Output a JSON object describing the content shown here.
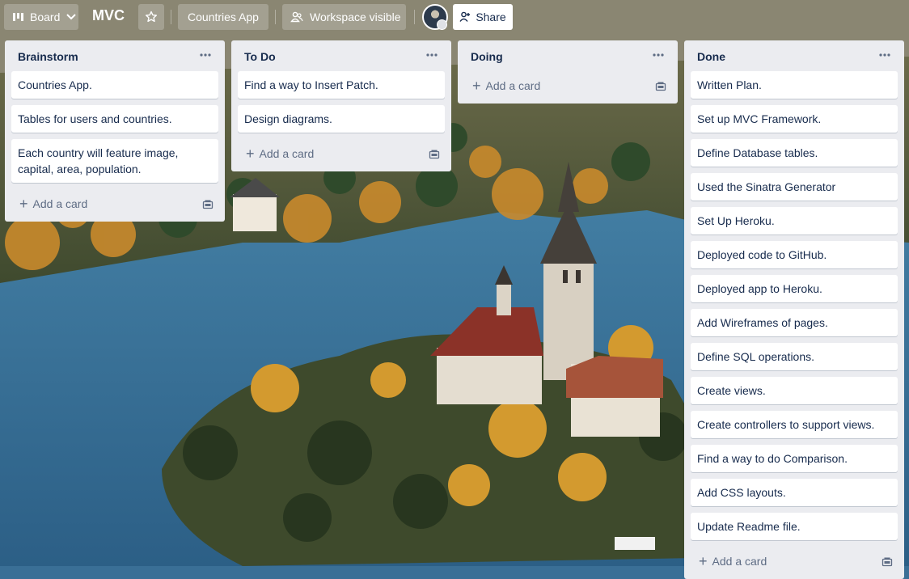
{
  "header": {
    "view_switch": "Board",
    "board_name": "MVC",
    "workspace": "Countries App",
    "visibility": "Workspace visible",
    "share": "Share"
  },
  "lists": [
    {
      "title": "Brainstorm",
      "cards": [
        "Countries App.",
        "Tables for users and countries.",
        "Each country will feature image, capital, area, population."
      ],
      "add_card": "Add a card"
    },
    {
      "title": "To Do",
      "cards": [
        "Find a way to Insert Patch.",
        "Design diagrams."
      ],
      "add_card": "Add a card"
    },
    {
      "title": "Doing",
      "cards": [],
      "add_card": "Add a card"
    },
    {
      "title": "Done",
      "cards": [
        "Written Plan.",
        "Set up MVC Framework.",
        "Define Database tables.",
        "Used the Sinatra Generator",
        "Set Up Heroku.",
        "Deployed code to GitHub.",
        "Deployed app to Heroku.",
        "Add Wireframes of pages.",
        "Define SQL operations.",
        "Create views.",
        "Create controllers to support views.",
        "Find a way to do Comparison.",
        "Add CSS layouts.",
        "Update Readme file."
      ],
      "add_card": "Add a card"
    }
  ],
  "icons": {
    "view_switch": "board-icon",
    "star": "star-icon",
    "visibility": "people-icon",
    "share": "add-person-icon",
    "list_menu": "more-icon",
    "template": "card-template-icon"
  },
  "colors": {
    "list_bg": "#ebecf0",
    "card_bg": "#ffffff",
    "text": "#172b4d",
    "muted": "#5e6c84"
  }
}
